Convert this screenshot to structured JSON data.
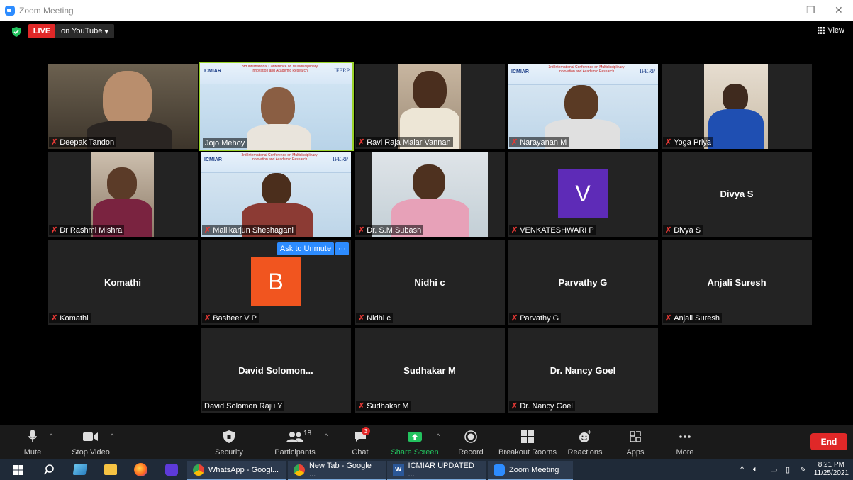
{
  "window": {
    "title": "Zoom Meeting",
    "controls": [
      "—",
      "❐",
      "✕"
    ]
  },
  "topbar": {
    "live": "LIVE",
    "stream": "on YouTube",
    "stream_caret": "▾",
    "view": "View"
  },
  "banner": {
    "org_left": "ICMIAR",
    "headline": "3rd International Conference on Multidisciplinary Innovation and Academic Research",
    "org_right": "IFERP"
  },
  "tiles": [
    {
      "name": "Deepak Tandon",
      "muted": true
    },
    {
      "name": "Jojo Mehoy",
      "muted": false
    },
    {
      "name": "Ravi Raja Malar Vannan",
      "muted": true
    },
    {
      "name": "Narayanan M",
      "muted": true
    },
    {
      "name": "Yoga Priya",
      "muted": true
    },
    {
      "name": "Dr Rashmi Mishra",
      "muted": true
    },
    {
      "name": "Mallikarjun Sheshagani",
      "muted": true
    },
    {
      "name": "Dr. S.M.Subash",
      "muted": true
    },
    {
      "name": "VENKATESHWARI P",
      "muted": true,
      "avatar": "V"
    },
    {
      "name": "Divya S",
      "muted": true,
      "display": "Divya S"
    },
    {
      "name": "Komathi",
      "muted": true,
      "display": "Komathi"
    },
    {
      "name": "Basheer V P",
      "muted": true,
      "avatar": "B"
    },
    {
      "name": "Nidhi c",
      "muted": true,
      "display": "Nidhi c"
    },
    {
      "name": "Parvathy G",
      "muted": true,
      "display": "Parvathy G"
    },
    {
      "name": "Anjali Suresh",
      "muted": true,
      "display": "Anjali Suresh"
    },
    {
      "name": "David Solomon Raju Y",
      "muted": false,
      "display": "David  Solomon..."
    },
    {
      "name": "Sudhakar M",
      "muted": true,
      "display": "Sudhakar M"
    },
    {
      "name": "Dr. Nancy Goel",
      "muted": true,
      "display": "Dr. Nancy Goel"
    }
  ],
  "hover": {
    "ask_unmute": "Ask to Unmute",
    "more": "···"
  },
  "toolbar": {
    "mute": "Mute",
    "stop_video": "Stop Video",
    "security": "Security",
    "participants": "Participants",
    "participants_count": "18",
    "chat": "Chat",
    "chat_badge": "3",
    "share_screen": "Share Screen",
    "record": "Record",
    "breakout": "Breakout Rooms",
    "reactions": "Reactions",
    "apps": "Apps",
    "more": "More",
    "end": "End"
  },
  "taskbar": {
    "apps": [
      {
        "label": "WhatsApp - Googl..."
      },
      {
        "label": "New Tab - Google ..."
      },
      {
        "label": "ICMIAR UPDATED ..."
      },
      {
        "label": "Zoom Meeting"
      }
    ],
    "time": "8:21 PM",
    "date": "11/25/2021"
  },
  "colors": {
    "live": "#e02828",
    "accent": "#2d8cff",
    "active_speaker": "#9ad22a",
    "share": "#23c35f",
    "avatar_v": "#5e2bb7",
    "avatar_b": "#f1551f"
  }
}
